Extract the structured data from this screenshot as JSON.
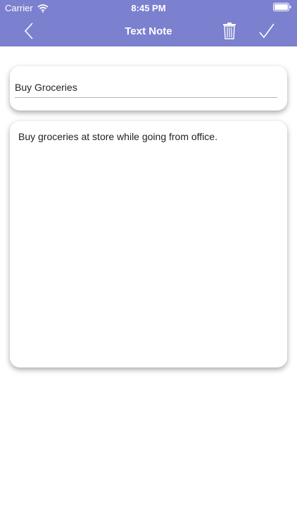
{
  "status_bar": {
    "carrier": "Carrier",
    "time": "8:45 PM",
    "wifi_icon": "wifi-icon",
    "battery_icon": "battery-icon"
  },
  "nav": {
    "title": "Text Note",
    "back_icon": "chevron-left-icon",
    "delete_icon": "trash-icon",
    "save_icon": "checkmark-icon"
  },
  "note": {
    "title_value": "Buy Groceries",
    "body_value": "Buy groceries at store while going from office."
  },
  "colors": {
    "header": "#7b80cf",
    "background": "#ffffff"
  }
}
